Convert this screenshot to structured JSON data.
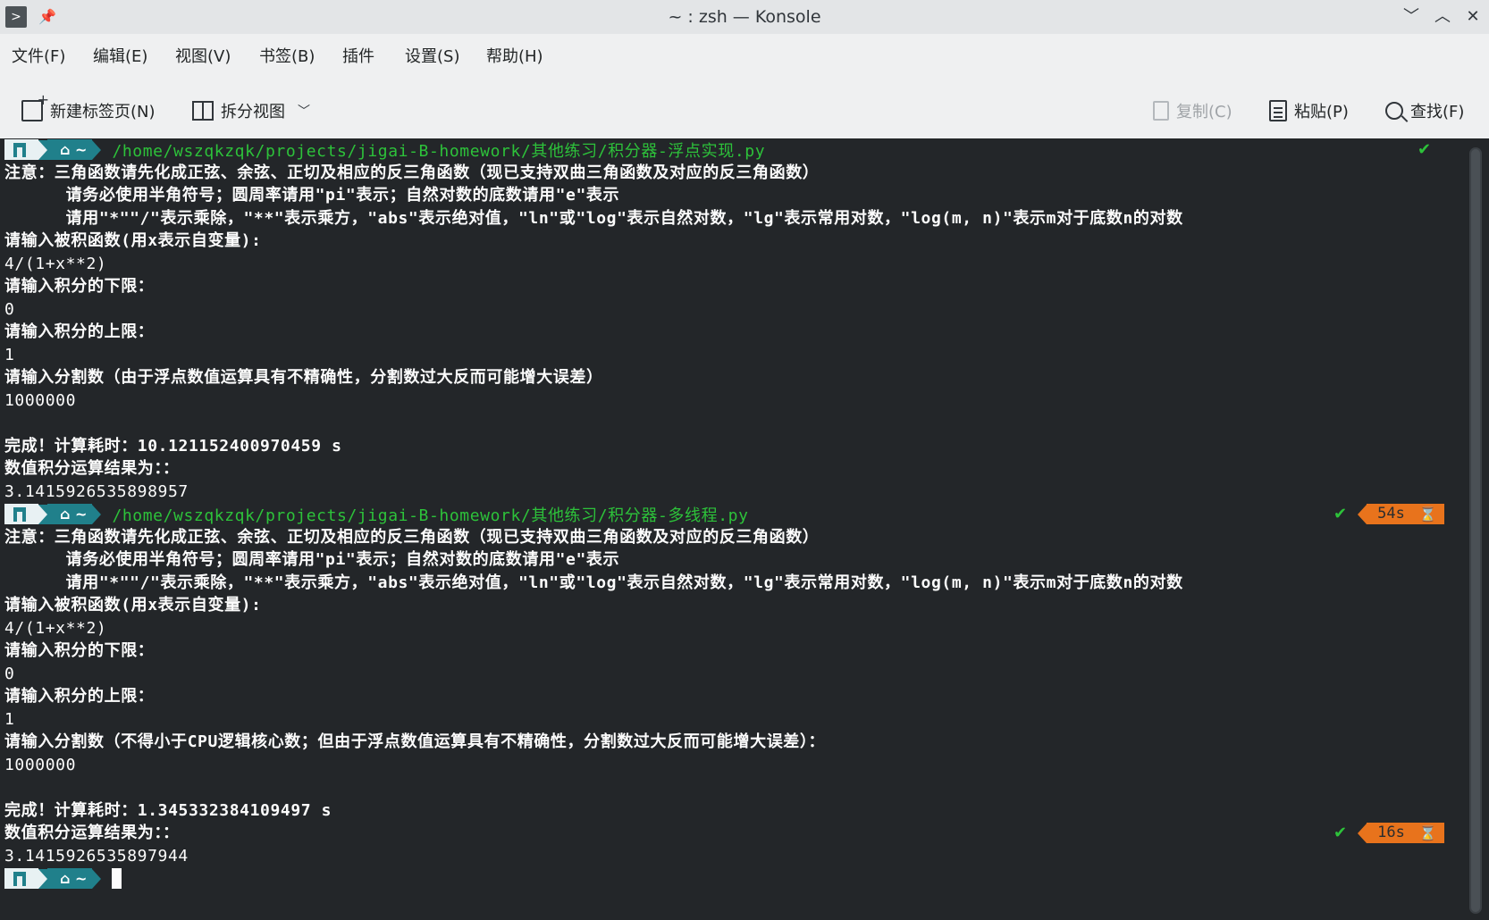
{
  "window": {
    "title": "~ : zsh — Konsole"
  },
  "menu": [
    "文件(F)",
    "编辑(E)",
    "视图(V)",
    "书签(B)",
    "插件",
    "设置(S)",
    "帮助(H)"
  ],
  "toolbar": {
    "new_tab": "新建标签页(N)",
    "split_view": "拆分视图",
    "copy": "复制(C)",
    "paste": "粘贴(P)",
    "find": "查找(F)"
  },
  "terminal": {
    "home": "~",
    "prompt1_path": "/home/wszqkzqk/projects/jigai-B-homework/其他练习/积分器-浮点实现.py",
    "block1": [
      "注意：三角函数请先化成正弦、余弦、正切及相应的反三角函数（现已支持双曲三角函数及对应的反三角函数）",
      "      请务必使用半角符号；圆周率请用\"pi\"表示；自然对数的底数请用\"e\"表示",
      "      请用\"*\"\"/\"表示乘除，\"**\"表示乘方，\"abs\"表示绝对值，\"ln\"或\"log\"表示自然对数，\"lg\"表示常用对数，\"log(m, n)\"表示m对于底数n的对数",
      "请输入被积函数(用x表示自变量):",
      "4/(1+x**2)",
      "请输入积分的下限：",
      "0",
      "请输入积分的上限：",
      "1",
      "请输入分割数（由于浮点数值运算具有不精确性，分割数过大反而可能增大误差）",
      "1000000",
      "",
      "完成！计算耗时：10.121152400970459 s",
      "数值积分运算结果为：：",
      "3.1415926535898957"
    ],
    "prompt2_path": "/home/wszqkzqk/projects/jigai-B-homework/其他练习/积分器-多线程.py",
    "prompt2_time": "54s",
    "block2": [
      "注意：三角函数请先化成正弦、余弦、正切及相应的反三角函数（现已支持双曲三角函数及对应的反三角函数）",
      "      请务必使用半角符号；圆周率请用\"pi\"表示；自然对数的底数请用\"e\"表示",
      "      请用\"*\"\"/\"表示乘除，\"**\"表示乘方，\"abs\"表示绝对值，\"ln\"或\"log\"表示自然对数，\"lg\"表示常用对数，\"log(m, n)\"表示m对于底数n的对数",
      "请输入被积函数(用x表示自变量):",
      "4/(1+x**2)",
      "请输入积分的下限：",
      "0",
      "请输入积分的上限：",
      "1",
      "请输入分割数（不得小于CPU逻辑核心数；但由于浮点数值运算具有不精确性，分割数过大反而可能增大误差）：",
      "1000000",
      "",
      "完成！计算耗时：1.345332384109497 s",
      "数值积分运算结果为：：",
      "3.1415926535897944"
    ],
    "prompt3_time": "16s",
    "check": "✔",
    "hourglass": "⌛"
  }
}
